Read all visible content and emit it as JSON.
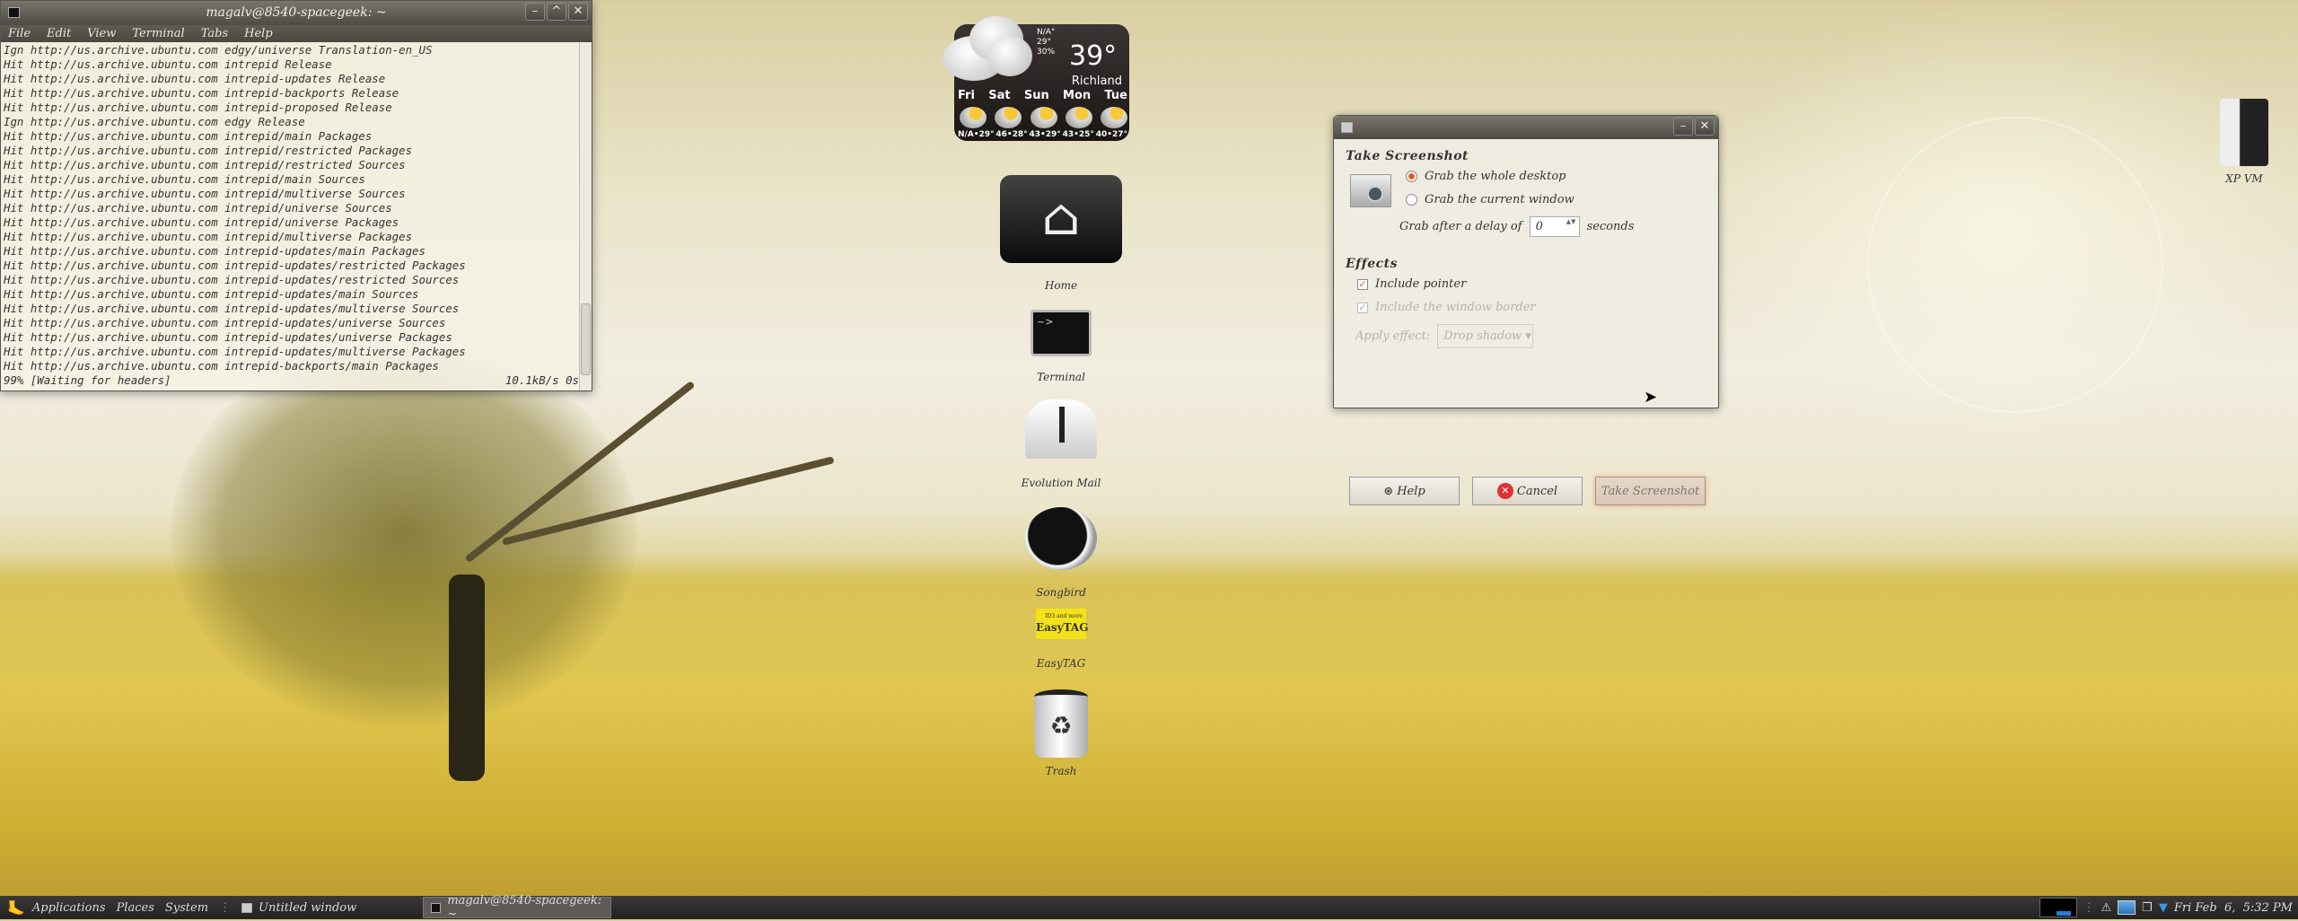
{
  "terminal": {
    "title": "magalv@8540-spacegeek: ~",
    "menu": [
      "File",
      "Edit",
      "View",
      "Terminal",
      "Tabs",
      "Help"
    ],
    "lines": [
      "Ign http://us.archive.ubuntu.com edgy/universe Translation-en_US",
      "Hit http://us.archive.ubuntu.com intrepid Release",
      "Hit http://us.archive.ubuntu.com intrepid-updates Release",
      "Hit http://us.archive.ubuntu.com intrepid-backports Release",
      "Hit http://us.archive.ubuntu.com intrepid-proposed Release",
      "Ign http://us.archive.ubuntu.com edgy Release",
      "Hit http://us.archive.ubuntu.com intrepid/main Packages",
      "Hit http://us.archive.ubuntu.com intrepid/restricted Packages",
      "Hit http://us.archive.ubuntu.com intrepid/restricted Sources",
      "Hit http://us.archive.ubuntu.com intrepid/main Sources",
      "Hit http://us.archive.ubuntu.com intrepid/multiverse Sources",
      "Hit http://us.archive.ubuntu.com intrepid/universe Sources",
      "Hit http://us.archive.ubuntu.com intrepid/universe Packages",
      "Hit http://us.archive.ubuntu.com intrepid/multiverse Packages",
      "Hit http://us.archive.ubuntu.com intrepid-updates/main Packages",
      "Hit http://us.archive.ubuntu.com intrepid-updates/restricted Packages",
      "Hit http://us.archive.ubuntu.com intrepid-updates/restricted Sources",
      "Hit http://us.archive.ubuntu.com intrepid-updates/main Sources",
      "Hit http://us.archive.ubuntu.com intrepid-updates/multiverse Sources",
      "Hit http://us.archive.ubuntu.com intrepid-updates/universe Sources",
      "Hit http://us.archive.ubuntu.com intrepid-updates/universe Packages",
      "Hit http://us.archive.ubuntu.com intrepid-updates/multiverse Packages",
      "Hit http://us.archive.ubuntu.com intrepid-backports/main Packages"
    ],
    "status_left": "99% [Waiting for headers]",
    "status_right": "10.1kB/s 0s"
  },
  "weather": {
    "now_hi": "N/A°",
    "now_lo": "29°",
    "humidity": "30%",
    "temp": "39°",
    "city": "Richland",
    "days": [
      {
        "day": "Fri",
        "temps": "N/A•29°"
      },
      {
        "day": "Sat",
        "temps": "46•28°"
      },
      {
        "day": "Sun",
        "temps": "43•29°"
      },
      {
        "day": "Mon",
        "temps": "43•25°"
      },
      {
        "day": "Tue",
        "temps": "40•27°"
      }
    ]
  },
  "desktop_icons": [
    "Home",
    "Terminal",
    "Evolution Mail",
    "Songbird",
    "EasyTAG",
    "Trash",
    "XP VM"
  ],
  "easytag_badge": {
    "small": "ID3 and more",
    "big": "EasyTAG"
  },
  "dialog": {
    "section_title": "Take Screenshot",
    "opt_desktop": "Grab the whole desktop",
    "opt_window": "Grab the current window",
    "delay_label": "Grab after a delay of",
    "delay_value": "0",
    "delay_unit": "seconds",
    "effects_title": "Effects",
    "include_pointer": "Include pointer",
    "include_border": "Include the window border",
    "apply_effect_label": "Apply effect:",
    "apply_effect_value": "Drop shadow",
    "help": "Help",
    "cancel": "Cancel",
    "take": "Take Screenshot"
  },
  "panel": {
    "menus": [
      "Applications",
      "Places",
      "System"
    ],
    "tasks": [
      "Untitled window",
      "magalv@8540-spacegeek: ~"
    ],
    "clock": "Fri Feb  6,  5:32 PM"
  }
}
